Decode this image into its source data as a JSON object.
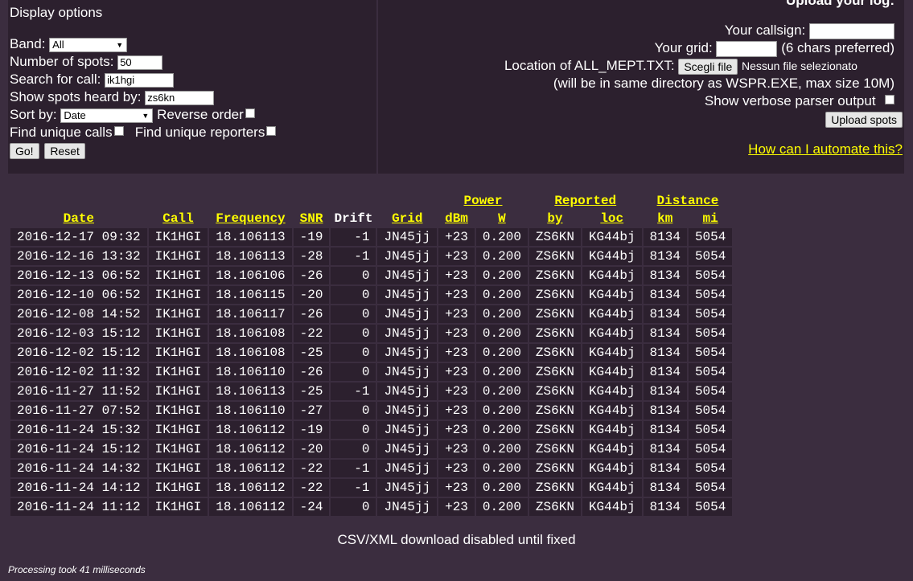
{
  "left": {
    "title": "Display options",
    "band_label": "Band:",
    "band_value": "All",
    "num_spots_label": "Number of spots:",
    "num_spots_value": "50",
    "search_call_label": "Search for call:",
    "search_call_value": "ik1hgi",
    "heard_by_label": "Show spots heard by:",
    "heard_by_value": "zs6kn",
    "sort_label": "Sort by:",
    "sort_value": "Date",
    "reverse_label": "Reverse order",
    "unique_calls_label": "Find unique calls",
    "unique_reporters_label": "Find unique reporters",
    "go_label": "Go!",
    "reset_label": "Reset"
  },
  "right": {
    "title": "Upload your log:",
    "callsign_label": "Your callsign:",
    "grid_label": "Your grid:",
    "grid_hint": "(6 chars preferred)",
    "location_label": "Location of ALL_MEPT.TXT:",
    "choose_file_label": "Scegli file",
    "no_file_label": "Nessun file selezionato",
    "location_hint": "(will be in same directory as WSPR.EXE, max size 10M)",
    "verbose_label": "Show verbose parser output",
    "upload_label": "Upload spots",
    "automate_link": "How can I automate this?"
  },
  "table": {
    "group_headers": {
      "power": "Power",
      "reported": "Reported",
      "distance": "Distance"
    },
    "headers": {
      "date": "Date",
      "call": "Call",
      "frequency": "Frequency",
      "snr": "SNR",
      "drift": "Drift",
      "grid": "Grid",
      "dbm": "dBm",
      "w": "W",
      "by": "by",
      "loc": "loc",
      "km": "km",
      "mi": "mi"
    },
    "rows": [
      [
        "2016-12-17 09:32",
        "IK1HGI",
        "18.106113",
        "-19",
        "-1",
        "JN45jj",
        "+23",
        "0.200",
        "ZS6KN",
        "KG44bj",
        "8134",
        "5054"
      ],
      [
        "2016-12-16 13:32",
        "IK1HGI",
        "18.106113",
        "-28",
        "-1",
        "JN45jj",
        "+23",
        "0.200",
        "ZS6KN",
        "KG44bj",
        "8134",
        "5054"
      ],
      [
        "2016-12-13 06:52",
        "IK1HGI",
        "18.106106",
        "-26",
        "0",
        "JN45jj",
        "+23",
        "0.200",
        "ZS6KN",
        "KG44bj",
        "8134",
        "5054"
      ],
      [
        "2016-12-10 06:52",
        "IK1HGI",
        "18.106115",
        "-20",
        "0",
        "JN45jj",
        "+23",
        "0.200",
        "ZS6KN",
        "KG44bj",
        "8134",
        "5054"
      ],
      [
        "2016-12-08 14:52",
        "IK1HGI",
        "18.106117",
        "-26",
        "0",
        "JN45jj",
        "+23",
        "0.200",
        "ZS6KN",
        "KG44bj",
        "8134",
        "5054"
      ],
      [
        "2016-12-03 15:12",
        "IK1HGI",
        "18.106108",
        "-22",
        "0",
        "JN45jj",
        "+23",
        "0.200",
        "ZS6KN",
        "KG44bj",
        "8134",
        "5054"
      ],
      [
        "2016-12-02 15:12",
        "IK1HGI",
        "18.106108",
        "-25",
        "0",
        "JN45jj",
        "+23",
        "0.200",
        "ZS6KN",
        "KG44bj",
        "8134",
        "5054"
      ],
      [
        "2016-12-02 11:32",
        "IK1HGI",
        "18.106110",
        "-26",
        "0",
        "JN45jj",
        "+23",
        "0.200",
        "ZS6KN",
        "KG44bj",
        "8134",
        "5054"
      ],
      [
        "2016-11-27 11:52",
        "IK1HGI",
        "18.106113",
        "-25",
        "-1",
        "JN45jj",
        "+23",
        "0.200",
        "ZS6KN",
        "KG44bj",
        "8134",
        "5054"
      ],
      [
        "2016-11-27 07:52",
        "IK1HGI",
        "18.106110",
        "-27",
        "0",
        "JN45jj",
        "+23",
        "0.200",
        "ZS6KN",
        "KG44bj",
        "8134",
        "5054"
      ],
      [
        "2016-11-24 15:32",
        "IK1HGI",
        "18.106112",
        "-19",
        "0",
        "JN45jj",
        "+23",
        "0.200",
        "ZS6KN",
        "KG44bj",
        "8134",
        "5054"
      ],
      [
        "2016-11-24 15:12",
        "IK1HGI",
        "18.106112",
        "-20",
        "0",
        "JN45jj",
        "+23",
        "0.200",
        "ZS6KN",
        "KG44bj",
        "8134",
        "5054"
      ],
      [
        "2016-11-24 14:32",
        "IK1HGI",
        "18.106112",
        "-22",
        "-1",
        "JN45jj",
        "+23",
        "0.200",
        "ZS6KN",
        "KG44bj",
        "8134",
        "5054"
      ],
      [
        "2016-11-24 14:12",
        "IK1HGI",
        "18.106112",
        "-22",
        "-1",
        "JN45jj",
        "+23",
        "0.200",
        "ZS6KN",
        "KG44bj",
        "8134",
        "5054"
      ],
      [
        "2016-11-24 11:12",
        "IK1HGI",
        "18.106112",
        "-24",
        "0",
        "JN45jj",
        "+23",
        "0.200",
        "ZS6KN",
        "KG44bj",
        "8134",
        "5054"
      ]
    ]
  },
  "footer": {
    "csv_note": "CSV/XML download disabled until fixed",
    "processing": "Processing took 41 milliseconds"
  }
}
